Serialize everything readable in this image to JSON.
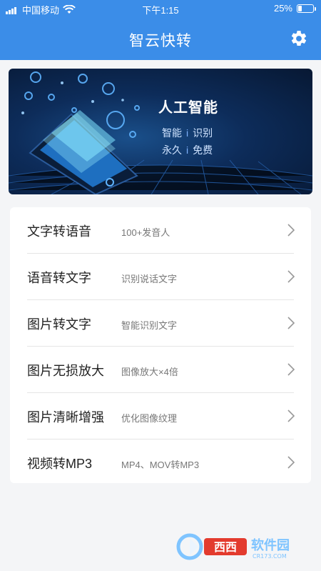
{
  "status": {
    "carrier": "中国移动",
    "time": "下午1:15",
    "battery": "25%",
    "battery_level": 0.25
  },
  "nav": {
    "title": "智云快转",
    "settings_icon": "gear-icon"
  },
  "banner": {
    "title": "人工智能",
    "line1_a": "智能",
    "line1_sep": "i",
    "line1_b": "识别",
    "line2_a": "永久",
    "line2_sep": "i",
    "line2_b": "免费"
  },
  "menu": [
    {
      "label": "文字转语音",
      "desc": "100+发音人"
    },
    {
      "label": "语音转文字",
      "desc": "识别说话文字"
    },
    {
      "label": "图片转文字",
      "desc": "智能识别文字"
    },
    {
      "label": "图片无损放大",
      "desc": "图像放大×4倍"
    },
    {
      "label": "图片清晰增强",
      "desc": "优化图像纹理"
    },
    {
      "label": "视频转MP3",
      "desc": "MP4、MOV转MP3"
    }
  ],
  "watermark": {
    "text": "西西软件园",
    "sub": "CR173.COM"
  },
  "colors": {
    "accent": "#3b8de8",
    "background": "#f4f5f7"
  }
}
